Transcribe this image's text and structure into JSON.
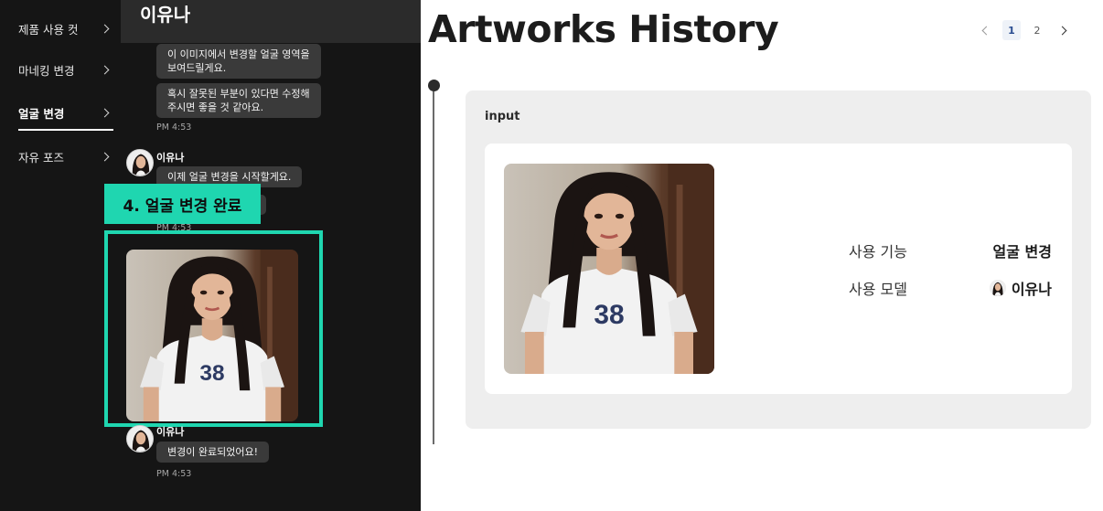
{
  "sidebar": {
    "items": [
      {
        "label": "제품 사용 컷"
      },
      {
        "label": "마네킹 변경"
      },
      {
        "label": "얼굴 변경",
        "active": true
      },
      {
        "label": "자유 포즈"
      }
    ]
  },
  "chat": {
    "header_title": "이유나",
    "messages": [
      {
        "text_line1": "이 이미지에서 변경할 얼굴 영역을",
        "text_line2": "보여드릴게요."
      },
      {
        "text_line1": "혹시 잘못된 부분이 있다면 수정해",
        "text_line2": "주시면 좋을 것 같아요."
      },
      {
        "text": "이제 얼굴 변경을 시작할게요."
      },
      {
        "text": "변경이 완료되었어요!"
      }
    ],
    "times": [
      "PM 4:53",
      "PM 4:53",
      "PM 4:53"
    ],
    "sender_name": "이유나",
    "step_label": "4. 얼굴 변경 완료",
    "shirt_number": "38"
  },
  "history": {
    "title": "Artworks History",
    "pagination": {
      "pages": [
        "1",
        "2"
      ],
      "current": "1"
    },
    "card": {
      "label": "input",
      "shirt_number": "38",
      "rows": [
        {
          "key": "사용 기능",
          "value": "얼굴 변경"
        },
        {
          "key": "사용 모델",
          "value": "이유나",
          "icon": "model-avatar-icon"
        }
      ]
    }
  },
  "colors": {
    "accent": "#1fd6b0",
    "dark_bg": "#151515",
    "bubble_bg": "#3a3a3a",
    "card_bg": "#eeeeee",
    "page_current": "#2a4d91"
  }
}
